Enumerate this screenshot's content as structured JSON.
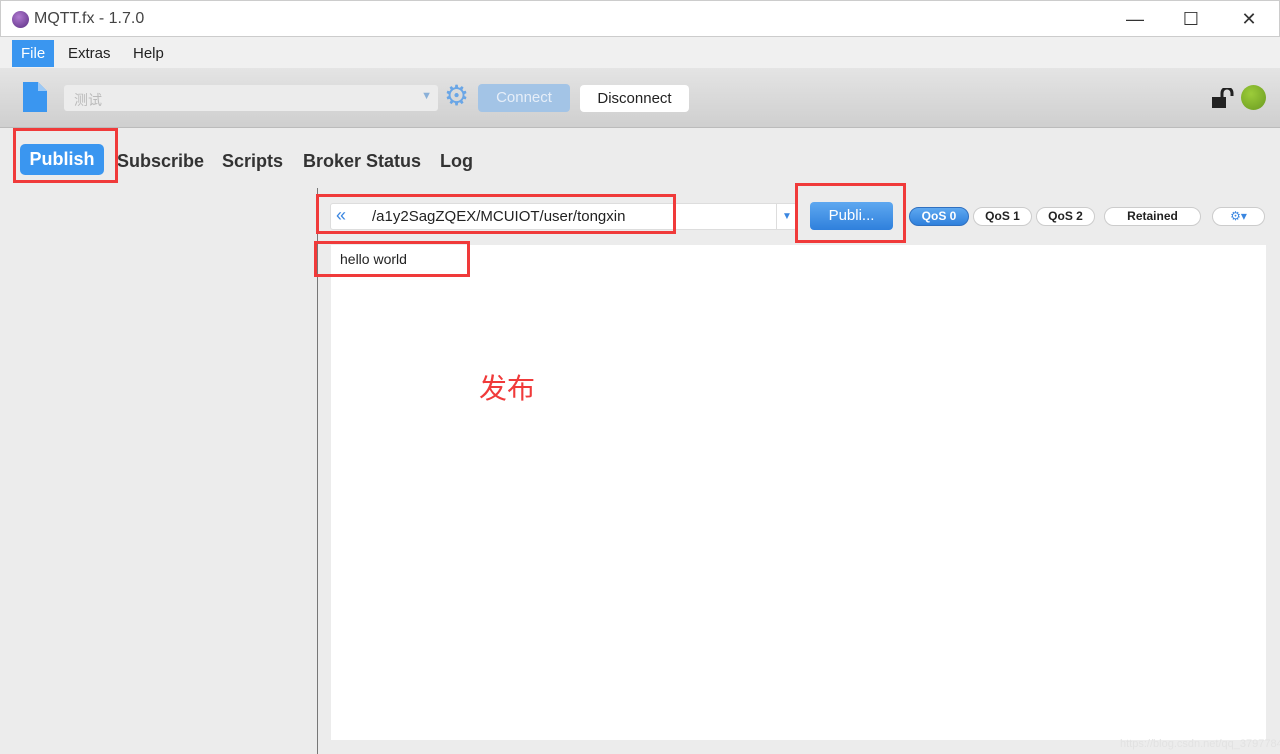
{
  "window": {
    "title": "MQTT.fx - 1.7.0",
    "minimize": "—",
    "maximize": "☐",
    "close": "✕"
  },
  "menu": [
    "File",
    "Extras",
    "Help"
  ],
  "toolbar": {
    "profile": "测试",
    "connect": "Connect",
    "disconnect": "Disconnect",
    "status_color": "#7ab52a"
  },
  "tabs": [
    "Publish",
    "Subscribe",
    "Scripts",
    "Broker Status",
    "Log"
  ],
  "publish": {
    "history": "«",
    "topic": "/a1y2SagZQEX/MCUIOT/user/tongxin",
    "publish_button": "Publi...",
    "qos": [
      "QoS 0",
      "QoS 1",
      "QoS 2"
    ],
    "selected_qos": "QoS 0",
    "retained": "Retained",
    "message": "hello world"
  },
  "annotation": {
    "text": "发布",
    "color": "#f03a3a"
  },
  "watermark": "https://blog.csdn.net/qq_37977847"
}
